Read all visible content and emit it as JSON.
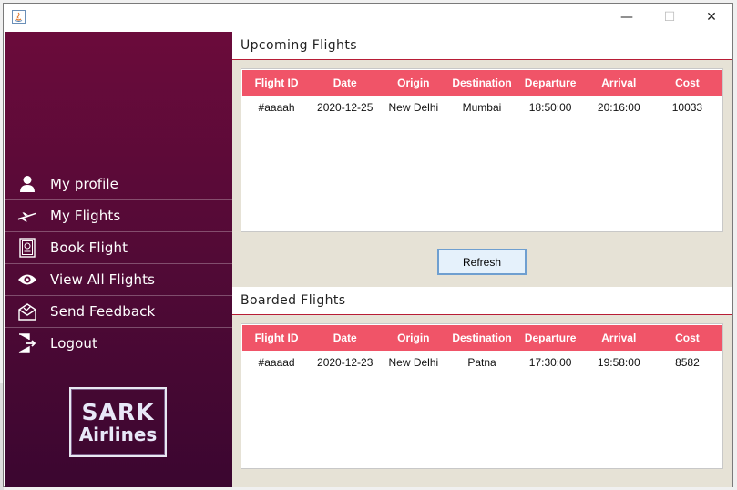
{
  "window": {
    "controls": {
      "minimize": "—",
      "maximize": "☐",
      "close": "✕"
    }
  },
  "sidebar": {
    "items": [
      {
        "label": "My profile",
        "icon": "user-icon"
      },
      {
        "label": "My Flights",
        "icon": "airplane-icon"
      },
      {
        "label": "Book Flight",
        "icon": "passport-icon"
      },
      {
        "label": "View All Flights",
        "icon": "eye-icon"
      },
      {
        "label": "Send Feedback",
        "icon": "mail-icon"
      },
      {
        "label": "Logout",
        "icon": "logout-icon"
      }
    ],
    "logo": {
      "line1": "SARK",
      "line2": "Airlines"
    }
  },
  "upcoming": {
    "title": "Upcoming Flights",
    "columns": [
      "Flight ID",
      "Date",
      "Origin",
      "Destination",
      "Departure",
      "Arrival",
      "Cost"
    ],
    "rows": [
      [
        "#aaaah",
        "2020-12-25",
        "New Delhi",
        "Mumbai",
        "18:50:00",
        "20:16:00",
        "10033"
      ]
    ]
  },
  "refresh_label": "Refresh",
  "boarded": {
    "title": "Boarded Flights",
    "columns": [
      "Flight ID",
      "Date",
      "Origin",
      "Destination",
      "Departure",
      "Arrival",
      "Cost"
    ],
    "rows": [
      [
        "#aaaad",
        "2020-12-23",
        "New Delhi",
        "Patna",
        "17:30:00",
        "19:58:00",
        "8582"
      ]
    ]
  },
  "colors": {
    "sidebar_top": "#6b0b3b",
    "sidebar_bottom": "#3b0630",
    "table_header": "#f05468",
    "section_rule": "#b81d36",
    "content_bg": "#e6e2d6"
  }
}
